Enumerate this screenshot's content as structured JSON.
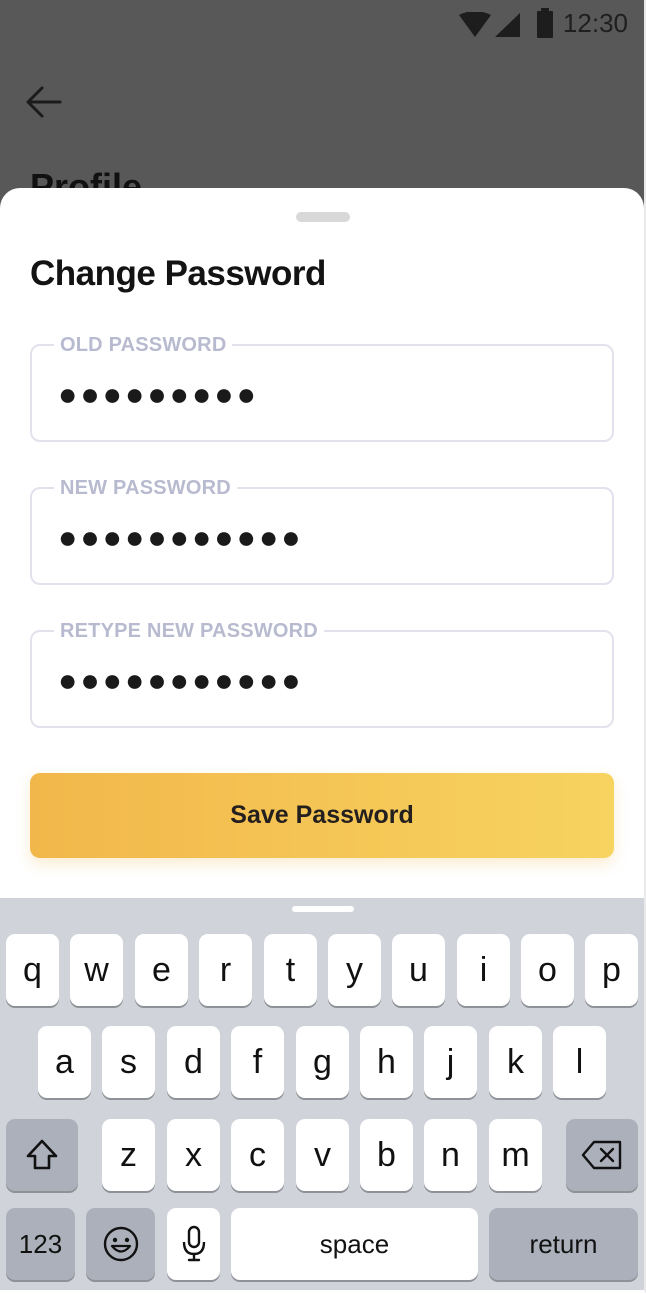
{
  "status_bar": {
    "time": "12:30",
    "icons": [
      "wifi-icon",
      "cellular-icon",
      "battery-icon"
    ]
  },
  "background_screen": {
    "title": "Profile"
  },
  "sheet": {
    "title": "Change Password",
    "fields": [
      {
        "label": "OLD PASSWORD",
        "value": "●●●●●●●●●"
      },
      {
        "label": "NEW PASSWORD",
        "value": "●●●●●●●●●●●"
      },
      {
        "label": "RETYPE NEW PASSWORD",
        "value": "●●●●●●●●●●●"
      }
    ],
    "save_button": "Save Password",
    "accent_colors": [
      "#f2b74a",
      "#f7d35f"
    ]
  },
  "keyboard": {
    "row1": [
      "q",
      "w",
      "e",
      "r",
      "t",
      "y",
      "u",
      "i",
      "o",
      "p"
    ],
    "row2": [
      "a",
      "s",
      "d",
      "f",
      "g",
      "h",
      "j",
      "k",
      "l"
    ],
    "row3": [
      "z",
      "x",
      "c",
      "v",
      "b",
      "n",
      "m"
    ],
    "numbers_key": "123",
    "space_key": "space",
    "return_key": "return",
    "icons": [
      "shift-icon",
      "backspace-icon",
      "emoji-icon",
      "microphone-icon"
    ]
  }
}
